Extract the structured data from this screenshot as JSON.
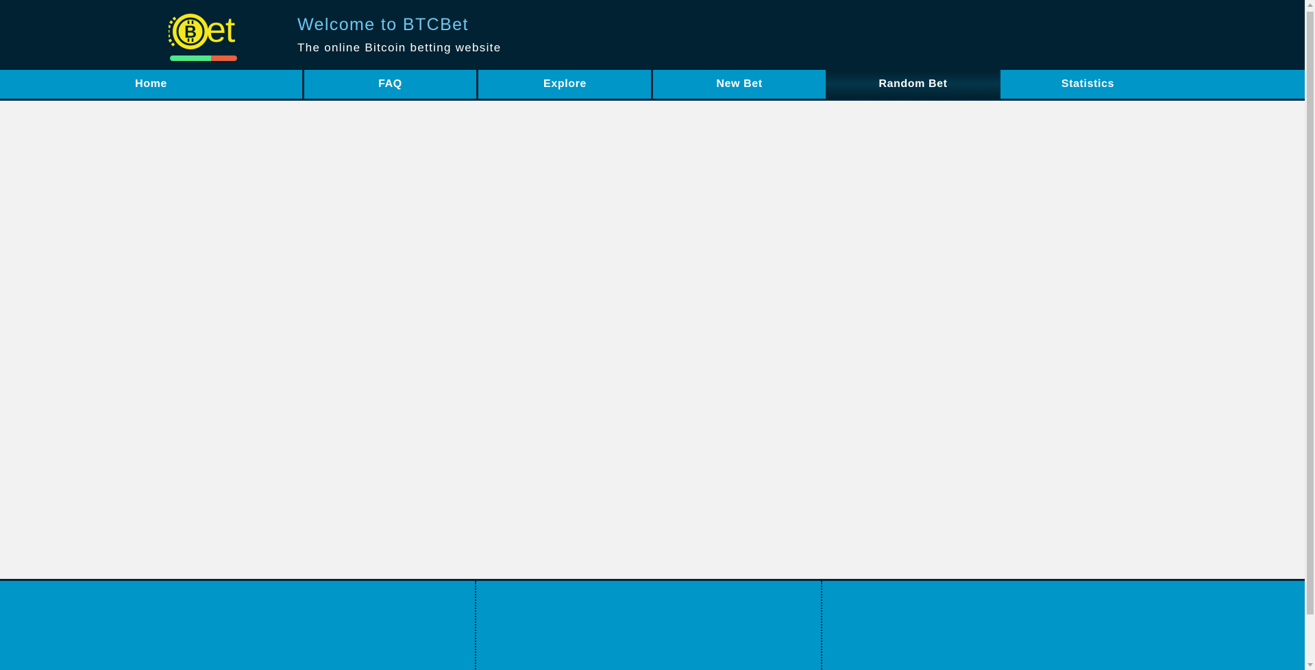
{
  "header": {
    "title": "Welcome to BTCBet",
    "subtitle": "The online Bitcoin betting website",
    "logo_text": "et",
    "logo_icon": "bitcoin-coin-icon"
  },
  "nav": {
    "items": [
      {
        "label": "Home",
        "active": false
      },
      {
        "label": "FAQ",
        "active": false
      },
      {
        "label": "Explore",
        "active": false
      },
      {
        "label": "New Bet",
        "active": false
      },
      {
        "label": "Random Bet",
        "active": true
      },
      {
        "label": "Statistics",
        "active": false
      }
    ]
  },
  "colors": {
    "header_bg": "#002232",
    "nav_bg": "#0096c8",
    "title": "#6fc6f2",
    "logo_yellow": "#f5e71b",
    "bar_green": "#4ee88a",
    "bar_red": "#e8623e",
    "page_bg": "#f2f2f2"
  }
}
